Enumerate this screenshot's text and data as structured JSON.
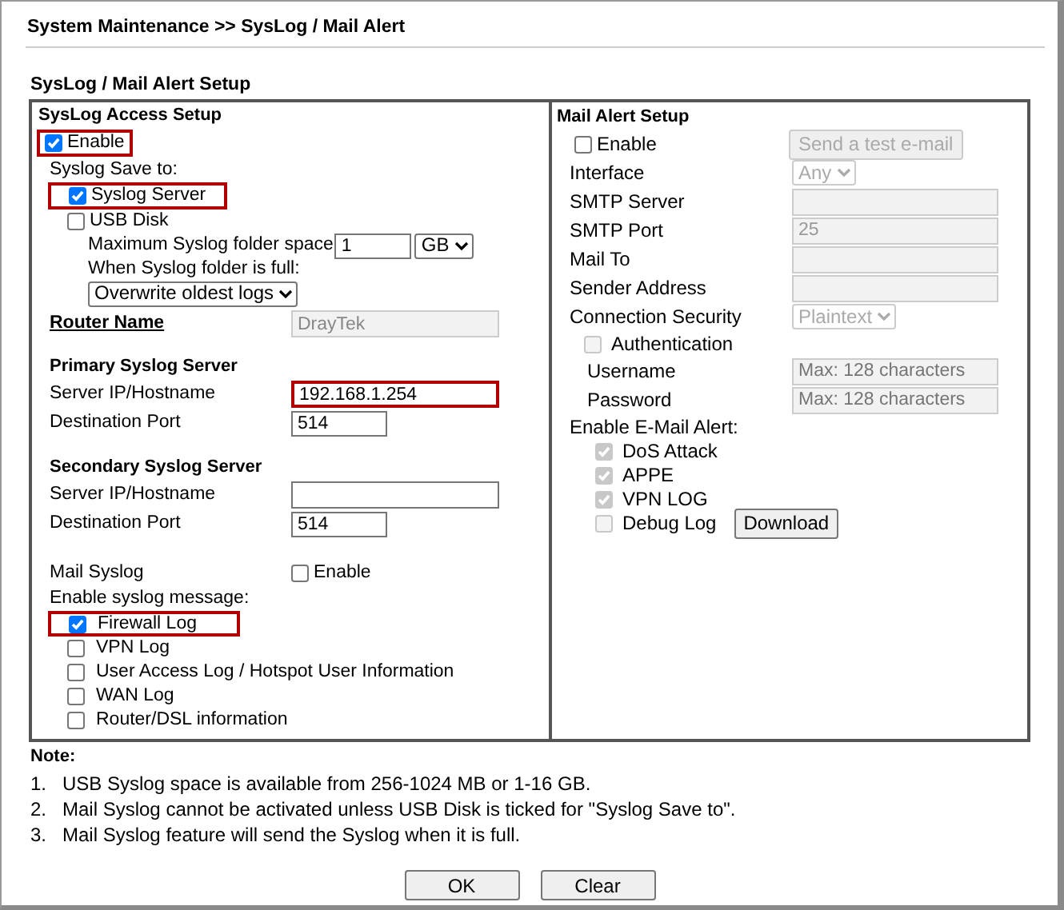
{
  "breadcrumb": "System Maintenance >> SysLog / Mail Alert",
  "section_title": "SysLog / Mail Alert Setup",
  "syslog": {
    "title": "SysLog Access Setup",
    "enable": {
      "label": "Enable",
      "checked": true,
      "highlighted": true
    },
    "save_to_label": "Syslog Save to:",
    "save_to": [
      {
        "label": "Syslog Server",
        "checked": true,
        "highlighted": true
      },
      {
        "label": "USB Disk",
        "checked": false,
        "highlighted": false
      }
    ],
    "max_space": {
      "label": "Maximum Syslog folder space",
      "value": "1",
      "unit": "GB"
    },
    "when_full": {
      "label": "When Syslog folder is full:",
      "value": "Overwrite oldest logs"
    },
    "router_name": {
      "label": "Router Name",
      "value": "DrayTek"
    },
    "servers": [
      {
        "title": "Primary Syslog Server",
        "host_label": "Server IP/Hostname",
        "host": "192.168.1.254",
        "host_highlighted": true,
        "port_label": "Destination Port",
        "port": "514"
      },
      {
        "title": "Secondary Syslog Server",
        "host_label": "Server IP/Hostname",
        "host_highlighted": false,
        "port_label": "Destination Port",
        "port": "514"
      }
    ],
    "mail_syslog": {
      "label": "Mail Syslog",
      "option": "Enable",
      "checked": false
    },
    "messages_label": "Enable syslog message:",
    "messages": [
      {
        "label": "Firewall Log",
        "checked": true,
        "highlighted": true
      },
      {
        "label": "VPN Log",
        "checked": false,
        "highlighted": false
      },
      {
        "label": "User Access Log / Hotspot User Information",
        "checked": false,
        "highlighted": false
      },
      {
        "label": "WAN Log",
        "checked": false,
        "highlighted": false
      },
      {
        "label": "Router/DSL information",
        "checked": false,
        "highlighted": false
      }
    ]
  },
  "mail_alert": {
    "title": "Mail Alert Setup",
    "disabled": true,
    "enable": {
      "label": "Enable",
      "checked": false
    },
    "test_button": "Send a test e-mail",
    "fields": [
      {
        "kind": "select",
        "label": "Interface",
        "value": "Any"
      },
      {
        "kind": "text",
        "label": "SMTP Server"
      },
      {
        "kind": "text",
        "label": "SMTP Port",
        "value": "25"
      },
      {
        "kind": "text",
        "label": "Mail To"
      },
      {
        "kind": "text",
        "label": "Sender Address"
      },
      {
        "kind": "select",
        "label": "Connection Security",
        "value": "Plaintext"
      }
    ],
    "authentication": {
      "label": "Authentication",
      "checked": false
    },
    "credentials": [
      {
        "label": "Username",
        "placeholder": "Max: 128 characters"
      },
      {
        "label": "Password",
        "placeholder": "Max: 128 characters"
      }
    ],
    "alerts_label": "Enable E-Mail Alert:",
    "alerts": [
      {
        "label": "DoS Attack",
        "checked": true
      },
      {
        "label": "APPE",
        "checked": true
      },
      {
        "label": "VPN LOG",
        "checked": true
      },
      {
        "label": "Debug Log",
        "checked": false
      }
    ],
    "download_button": "Download"
  },
  "note": {
    "title": "Note:",
    "items": [
      {
        "number": "1.",
        "text": "USB Syslog space is available from 256-1024 MB or 1-16 GB."
      },
      {
        "number": "2.",
        "text": "Mail Syslog cannot be activated unless USB Disk is ticked for \"Syslog Save to\"."
      },
      {
        "number": "3.",
        "text": "Mail Syslog feature will send the Syslog when it is full."
      }
    ]
  },
  "buttons": [
    "OK",
    "Clear"
  ]
}
